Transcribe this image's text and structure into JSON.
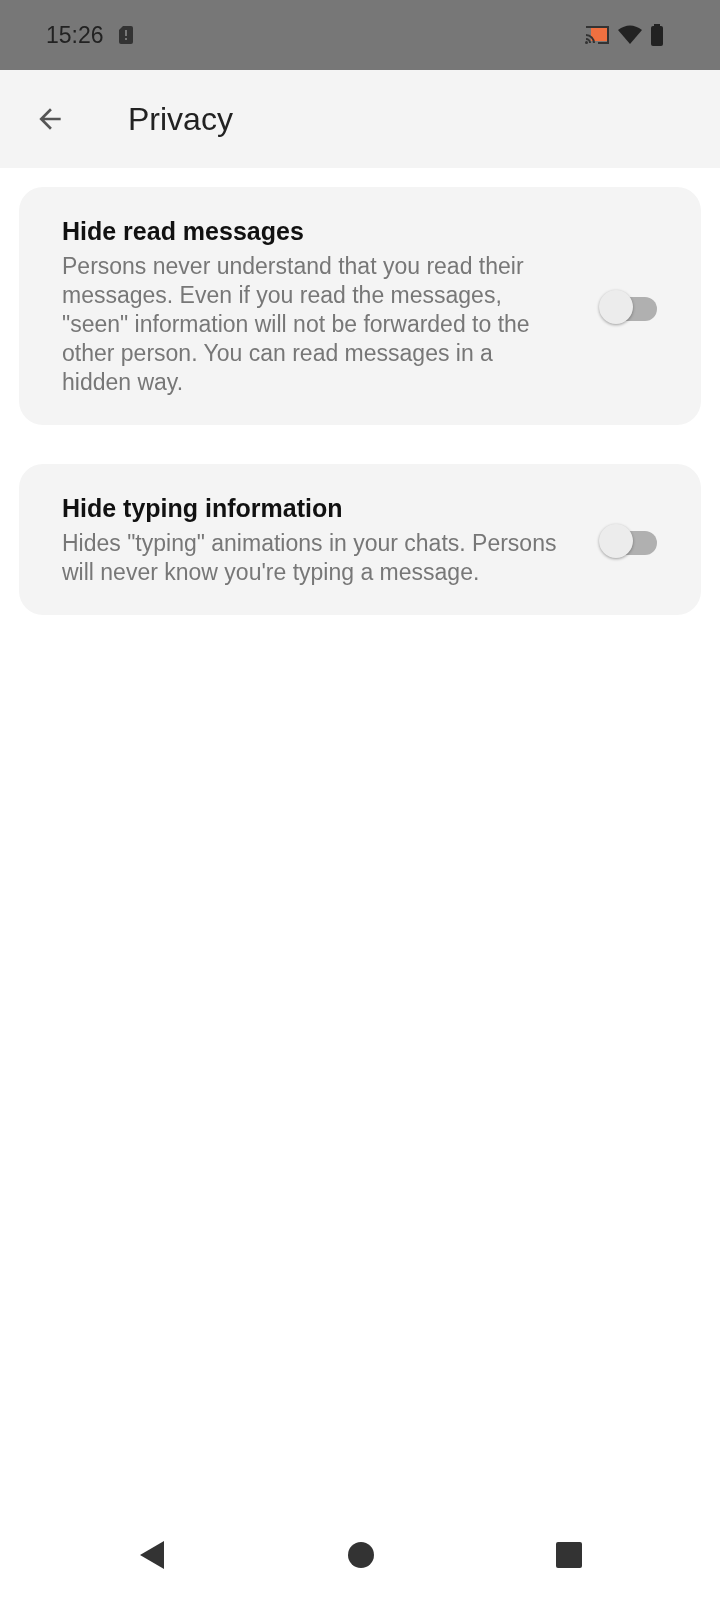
{
  "status_bar": {
    "time": "15:26"
  },
  "app_bar": {
    "title": "Privacy"
  },
  "settings": [
    {
      "title": "Hide read messages",
      "description": "Persons never understand that you read their messages. Even if you read the messages, \"seen\" information will not be forwarded to the other person. You can read messages in a hidden way.",
      "on": false
    },
    {
      "title": "Hide typing information",
      "description": "Hides \"typing\" animations in your chats. Persons will never know you're typing a message.",
      "on": false
    }
  ]
}
